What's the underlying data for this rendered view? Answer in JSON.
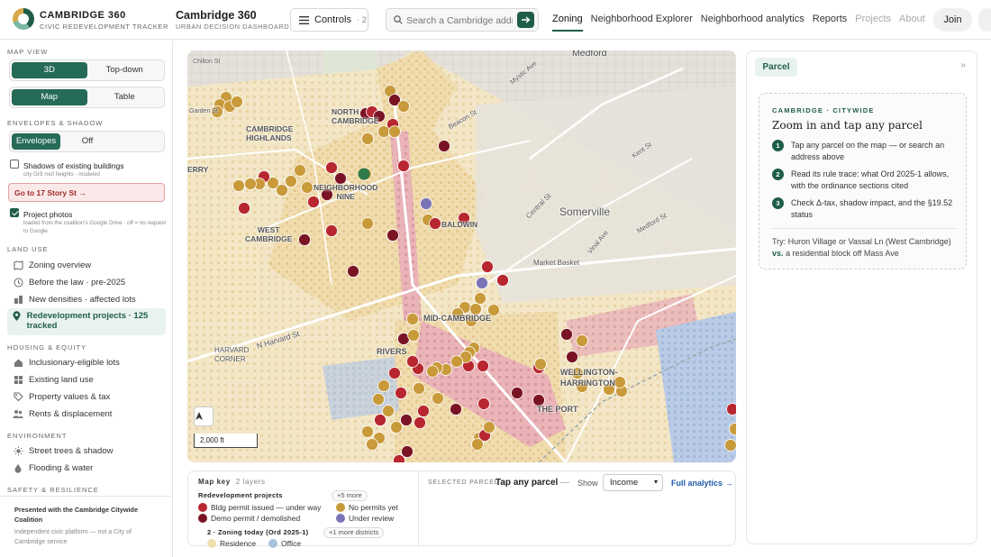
{
  "header": {
    "brand_title": "CAMBRIDGE 360",
    "brand_subtitle": "CIVIC REDEVELOPMENT TRACKER",
    "app_title": "Cambridge 360",
    "app_subtitle": "URBAN DECISION DASHBOARD",
    "controls_label": "Controls",
    "controls_count": "· 2",
    "search_placeholder": "Search a Cambridge address",
    "nav": [
      "Zoning",
      "Neighborhood Explorer",
      "Neighborhood analytics",
      "Reports",
      "Projects",
      "About"
    ],
    "join_label": "Join"
  },
  "sidebar": {
    "map_view_heading": "MAP VIEW",
    "view_modes": [
      "3D",
      "Top-down"
    ],
    "display_modes": [
      "Map",
      "Table"
    ],
    "envelopes_heading": "ENVELOPES & SHADOW",
    "envelope_modes": [
      "Envelopes",
      "Off"
    ],
    "shadows_label": "Shadows of existing buildings",
    "shadows_sub": "city GIS roof heights · modeled",
    "goto_label": "Go to 17 Story St →",
    "photos_label": "Project photos",
    "photos_sub": "loaded from the coalition's Google Drive · off = no request to Google",
    "land_use_heading": "LAND USE",
    "land_use_items": [
      "Zoning overview",
      "Before the law · pre-2025",
      "New densities · affected lots",
      "Redevelopment projects · 125 tracked"
    ],
    "housing_heading": "HOUSING & EQUITY",
    "housing_items": [
      "Inclusionary-eligible lots",
      "Existing land use",
      "Property values & tax",
      "Rents & displacement"
    ],
    "environment_heading": "ENVIRONMENT",
    "environment_items": [
      "Street trees & shadow",
      "Flooding & water"
    ],
    "safety_heading": "SAFETY & RESILIENCE",
    "footer_presented": "Presented with the Cambridge Citywide Coalition",
    "footer_note": "Independent civic platform — not a City of Cambridge service"
  },
  "map": {
    "labels": {
      "medford": "Medford",
      "north_cambridge": "NORTH\nCAMBRIDGE",
      "cambridge_highlands": "CAMBRIDGE\nHIGHLANDS",
      "neighborhood_nine": "NEIGHBORHOOD\nNINE",
      "west_cambridge": "WEST\nCAMBRIDGE",
      "baldwin": "BALDWIN",
      "somerville": "Somerville",
      "mid_cambridge": "MID-CAMBRIDGE",
      "riverside": "RIVERS",
      "wellington_harrington": "WELLINGTON-\nHARRINGTON",
      "the_port": "THE PORT",
      "harvard_st": "N Harvard St",
      "central_st": "Central St",
      "market_basket": "Market Basket",
      "vinal_ave": "Vinal Ave",
      "medford_st": "Medford St",
      "beacon_st": "Beacon St",
      "kent_st": "Kent St",
      "berry": "ERRY",
      "garden_st": "Garden St",
      "chilton_st": "Chilton St",
      "harvard_corner": "HARVARD\nCORNER",
      "mystic": "Mystic Ave"
    },
    "scale_label": "2,000 ft",
    "compass_label": "N"
  },
  "legend": {
    "key_label": "Map key",
    "layers_count": "2 layers",
    "group1_title": "Redevelopment projects",
    "group1_more": "+5 more",
    "items": [
      {
        "label": "Bldg permit issued — under way",
        "color": "#b8262f"
      },
      {
        "label": "No permits yet",
        "color": "#c89a3a"
      },
      {
        "label": "Demo permit / demolished",
        "color": "#7a1424"
      },
      {
        "label": "Under review",
        "color": "#7b73b8"
      }
    ],
    "group2_title": "2 · Zoning today (Ord 2025-1)",
    "group2_more": "+1 more districts",
    "zones": [
      {
        "label": "Residence",
        "color": "#f2e0b0"
      },
      {
        "label": "Office",
        "color": "#a9c2e0"
      }
    ]
  },
  "selection": {
    "label": "SELECTED PARCEL",
    "value": "Tap any parcel",
    "dash": "—",
    "show_label": "Show",
    "show_value": "Income",
    "full_analytics": "Full analytics →"
  },
  "panel": {
    "tab_label": "Parcel",
    "collapse_glyph": "»",
    "kicker": "CAMBRIDGE · CITYWIDE",
    "title": "Zoom in and tap any parcel",
    "steps": [
      "Tap any parcel on the map — or search an address above",
      "Read its rule trace: what Ord 2025-1 allows, with the ordinance sections cited",
      "Check Δ-tax, shadow impact, and the §19.52 status"
    ],
    "try_text": "Try: Huron Village or Vassal Ln (West Cambridge)",
    "try_vs": "vs.",
    "try_tail": "a residential block off Mass Ave"
  },
  "colors": {
    "accent": "#1f5d4a",
    "permit": "#b8262f",
    "no_permit": "#c89a3a",
    "demo": "#7a1424",
    "review": "#7b73b8"
  }
}
